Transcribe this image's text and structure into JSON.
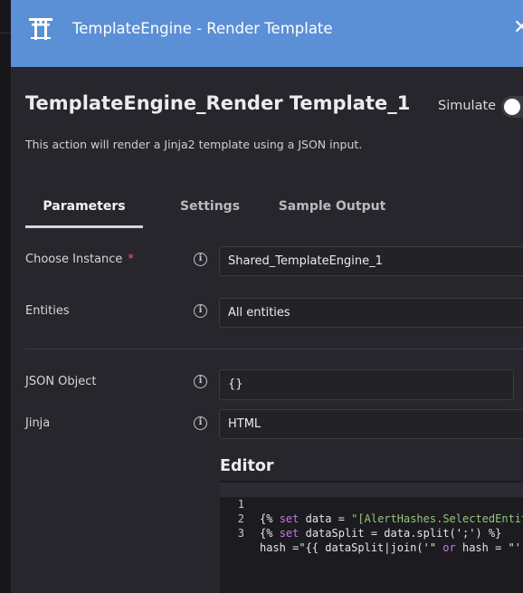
{
  "header": {
    "title": "TemplateEngine - Render Template",
    "logo_icon": "torii-gate-icon",
    "close_icon": "close-icon"
  },
  "action": {
    "title": "TemplateEngine_Render Template_1",
    "description": "This action will render a Jinja2 template using a JSON input.",
    "simulate_label": "Simulate",
    "simulate_on": false
  },
  "tabs": [
    {
      "label": "Parameters",
      "active": true
    },
    {
      "label": "Settings",
      "active": false
    },
    {
      "label": "Sample Output",
      "active": false
    }
  ],
  "params": {
    "instance": {
      "label": "Choose Instance",
      "required_mark": "*",
      "value": "Shared_TemplateEngine_1"
    },
    "entities": {
      "label": "Entities",
      "value": "All entities"
    },
    "json_object": {
      "label": "JSON Object",
      "value": "{}"
    },
    "jinja": {
      "label": "Jinja",
      "value": "HTML"
    }
  },
  "editor": {
    "title": "Editor",
    "lines": [
      {
        "num": "1",
        "pre": "{% ",
        "kw": "set",
        "mid": " data = ",
        "str": "\"[AlertHashes.SelectedEntit",
        "post": ""
      },
      {
        "num": "2",
        "pre": "{% ",
        "kw": "set",
        "mid": " dataSplit = data.split(';') %}",
        "str": "",
        "post": ""
      },
      {
        "num": "3",
        "pre": "hash =\"{{ dataSplit|join('\" ",
        "kw": "or",
        "mid": " hash = \"')",
        "str": "",
        "post": ""
      }
    ]
  },
  "colors": {
    "header_bg": "#5b8fd6",
    "panel_bg": "#26262c",
    "required": "#e06262"
  }
}
